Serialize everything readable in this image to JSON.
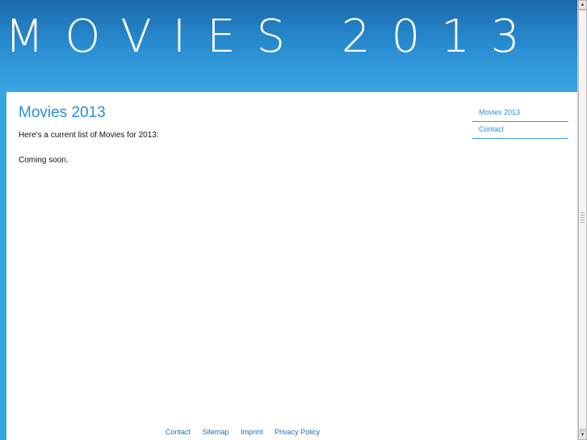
{
  "banner": {
    "title": "MOVIES 2013"
  },
  "main": {
    "title": "Movies 2013",
    "intro": "Here's a current list of Movies for 2013:",
    "status": "Coming soon."
  },
  "sidenav": {
    "items": [
      {
        "label": "Movies 2013"
      },
      {
        "label": "Contact"
      }
    ]
  },
  "footer": {
    "links": [
      {
        "label": "Contact"
      },
      {
        "label": "Sitemap"
      },
      {
        "label": "Imprint"
      },
      {
        "label": "Privacy Policy"
      }
    ]
  },
  "colors": {
    "brand_blue": "#2a8ed3",
    "banner_dark": "#1b6aad",
    "sidebar_blue": "#39a6e3"
  }
}
